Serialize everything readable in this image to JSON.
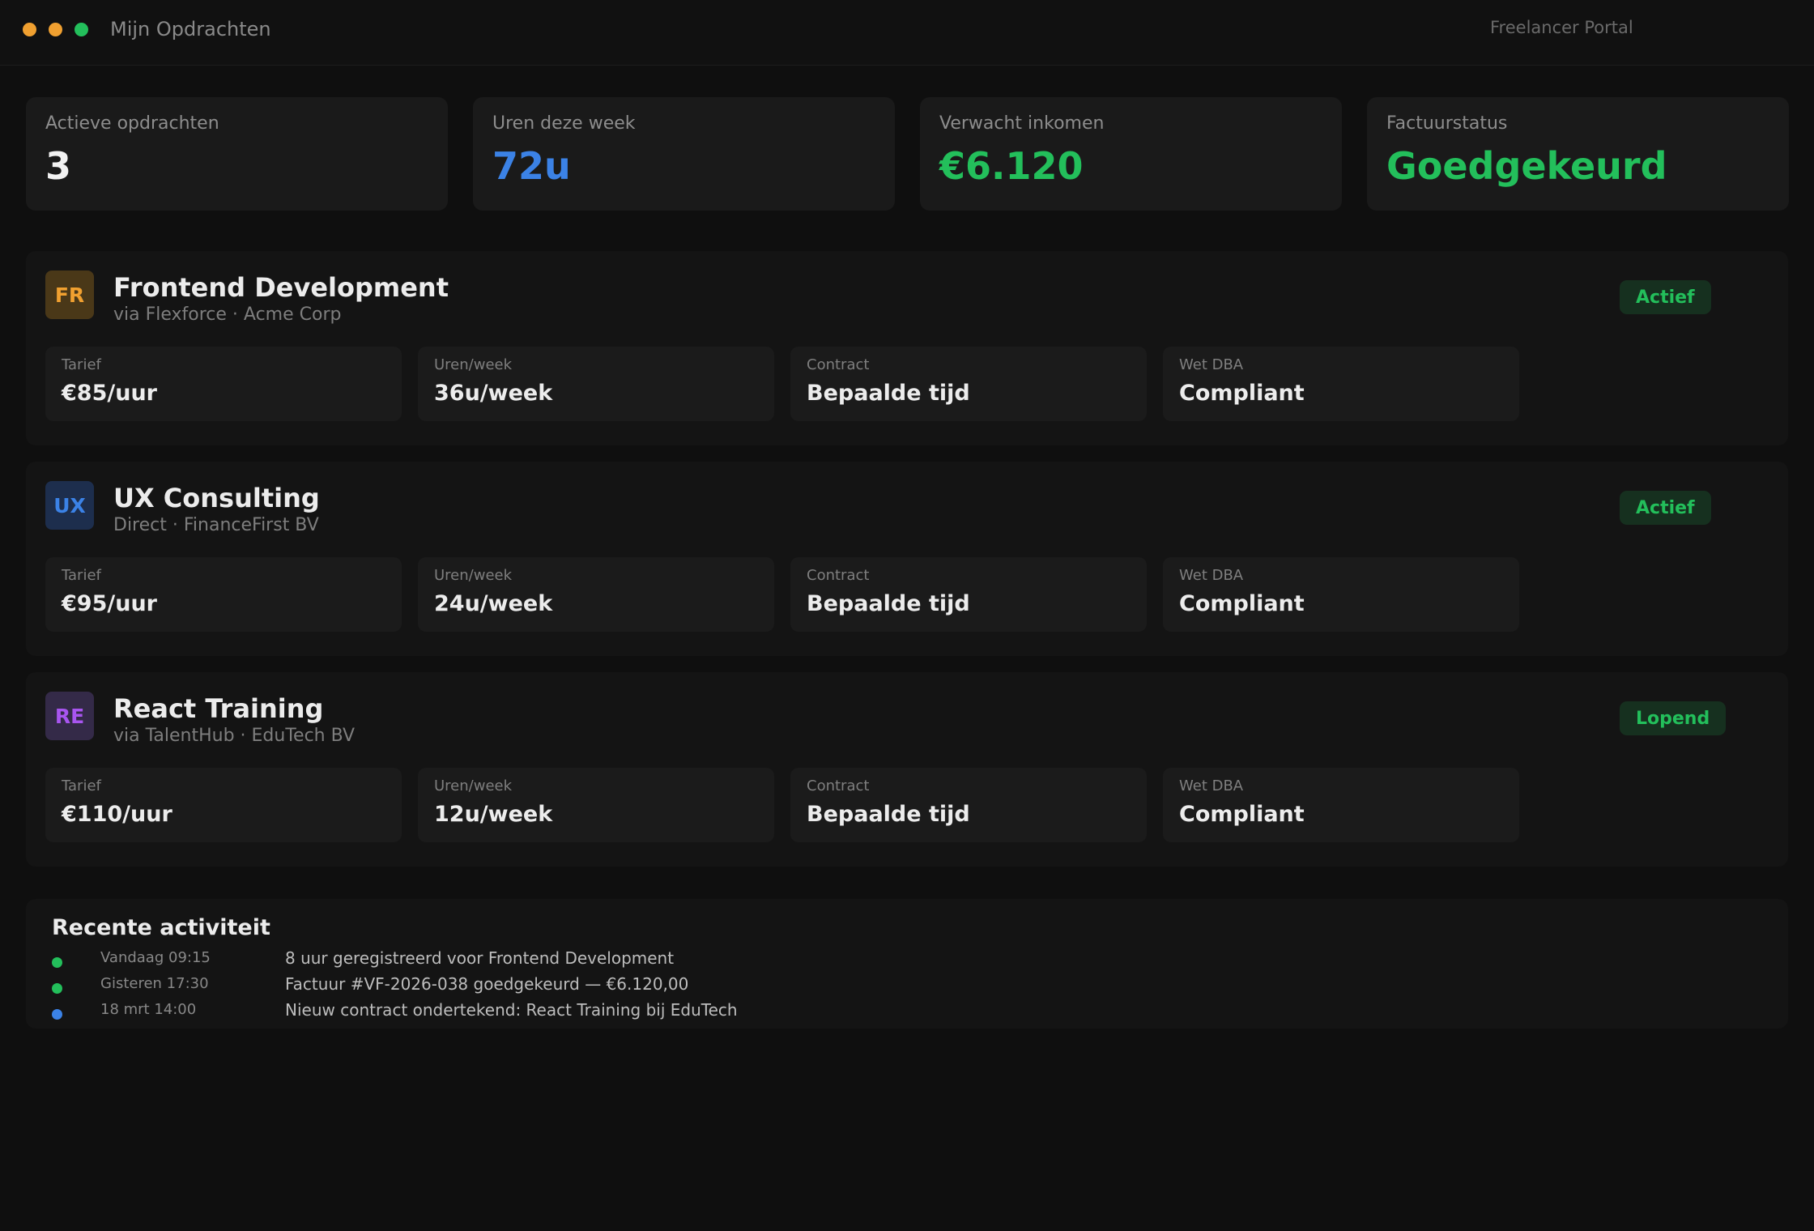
{
  "window": {
    "title": "Mijn Opdrachten",
    "portal_label": "Freelancer Portal",
    "controls": [
      {
        "name": "close",
        "color": "#f0a030"
      },
      {
        "name": "minimize",
        "color": "#f0a030"
      },
      {
        "name": "maximize",
        "color": "#23bf5b"
      }
    ]
  },
  "stats": [
    {
      "label": "Actieve opdrachten",
      "value": "3",
      "color": "#f2f2f2"
    },
    {
      "label": "Uren deze week",
      "value": "72u",
      "color": "#3b82e6"
    },
    {
      "label": "Verwacht inkomen",
      "value": "€6.120",
      "color": "#23bf5b"
    },
    {
      "label": "Factuurstatus",
      "value": "Goedgekeurd",
      "color": "#23bf5b"
    }
  ],
  "projects": [
    {
      "initials": "FR",
      "avatar_bg": "#4a3818",
      "avatar_fg": "#f0a030",
      "title": "Frontend Development",
      "subtitle": "via Flexforce · Acme Corp",
      "status": "Actief",
      "details": [
        {
          "label": "Tarief",
          "value": "€85/uur"
        },
        {
          "label": "Uren/week",
          "value": "36u/week"
        },
        {
          "label": "Contract",
          "value": "Bepaalde tijd"
        },
        {
          "label": "Wet DBA",
          "value": "Compliant"
        }
      ]
    },
    {
      "initials": "UX",
      "avatar_bg": "#1d2e4d",
      "avatar_fg": "#3b82e6",
      "title": "UX Consulting",
      "subtitle": "Direct · FinanceFirst BV",
      "status": "Actief",
      "details": [
        {
          "label": "Tarief",
          "value": "€95/uur"
        },
        {
          "label": "Uren/week",
          "value": "24u/week"
        },
        {
          "label": "Contract",
          "value": "Bepaalde tijd"
        },
        {
          "label": "Wet DBA",
          "value": "Compliant"
        }
      ]
    },
    {
      "initials": "RE",
      "avatar_bg": "#342a48",
      "avatar_fg": "#a855f0",
      "title": "React Training",
      "subtitle": "via TalentHub · EduTech BV",
      "status": "Lopend",
      "details": [
        {
          "label": "Tarief",
          "value": "€110/uur"
        },
        {
          "label": "Uren/week",
          "value": "12u/week"
        },
        {
          "label": "Contract",
          "value": "Bepaalde tijd"
        },
        {
          "label": "Wet DBA",
          "value": "Compliant"
        }
      ]
    }
  ],
  "activity": {
    "title": "Recente activiteit",
    "items": [
      {
        "time": "Vandaag 09:15",
        "text": "8 uur geregistreerd voor Frontend Development",
        "color": "#23bf5b"
      },
      {
        "time": "Gisteren 17:30",
        "text": "Factuur #VF-2026-038 goedgekeurd — €6.120,00",
        "color": "#23bf5b"
      },
      {
        "time": "18 mrt 14:00",
        "text": "Nieuw contract ondertekend: React Training bij EduTech",
        "color": "#3b82e6"
      }
    ]
  }
}
